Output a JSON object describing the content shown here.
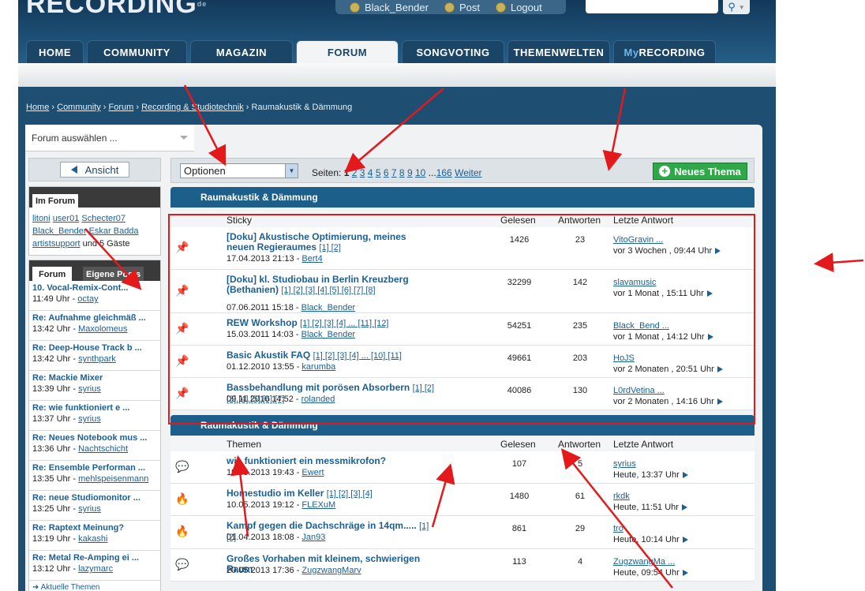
{
  "logo": {
    "text": "RECORDING",
    "suffix": "de"
  },
  "userbar": {
    "user": "Black_Bender",
    "post": "Post",
    "logout": "Logout"
  },
  "search": {
    "placeholder": ""
  },
  "nav": {
    "tabs": [
      "HOME",
      "COMMUNITY",
      "MAGAZIN",
      "FORUM",
      "SONGVOTING",
      "THEMENWELTEN"
    ],
    "my_prefix": "My",
    "my_suffix": "RECORDING",
    "active": "FORUM"
  },
  "breadcrumb": [
    "Home",
    "Community",
    "Forum",
    "Recording & Studiotechnik",
    "Raumakustik & Dämmung"
  ],
  "forum_select": {
    "label": "Forum auswählen ..."
  },
  "sidebar": {
    "ansicht": "Ansicht",
    "im_forum": {
      "title": "Im Forum",
      "users": [
        "litoni",
        "user01",
        "Schecter07",
        "Black_Bender",
        "Eskar Badda",
        "artistsupport"
      ],
      "guests": "und 5 Gäste"
    },
    "tabs": [
      "Forum",
      "Eigene Posts"
    ],
    "posts": [
      {
        "title": "10. Vocal-Remix-Cont...",
        "time": "11:49 Uhr",
        "user": "octay"
      },
      {
        "title": "Re: Aufnahme gleichmäß ...",
        "time": "13:42 Uhr",
        "user": "Maxolomeus"
      },
      {
        "title": "Re: Deep-House Track b ...",
        "time": "13:42 Uhr",
        "user": "synthpark"
      },
      {
        "title": "Re: Mackie Mixer",
        "time": "13:39 Uhr",
        "user": "syrius"
      },
      {
        "title": "Re: wie funktioniert e ...",
        "time": "13:37 Uhr",
        "user": "syrius"
      },
      {
        "title": "Re: Neues Notebook mus ...",
        "time": "13:36 Uhr",
        "user": "Nachtschicht"
      },
      {
        "title": "Re: Ensemble Performan ...",
        "time": "13:35 Uhr",
        "user": "mehlspeisenmann"
      },
      {
        "title": "Re: neue Studiomonitor ...",
        "time": "13:25 Uhr",
        "user": "syrius"
      },
      {
        "title": "Re: Raptext Meinung?",
        "time": "13:19 Uhr",
        "user": "kakashi"
      },
      {
        "title": "Re: Metal Re-Amping ei ...",
        "time": "13:12 Uhr",
        "user": "lazymarc"
      }
    ],
    "more": "Aktuelle Themen"
  },
  "toolbar": {
    "options": "Optionen",
    "pages_label": "Seiten:",
    "pages": [
      "1",
      "2",
      "3",
      "4",
      "5",
      "6",
      "7",
      "8",
      "9",
      "10"
    ],
    "ellipsis": "...",
    "last_page": "166",
    "next": "Weiter",
    "new_thread": "Neues Thema"
  },
  "columns": {
    "sticky": "Sticky",
    "themen": "Themen",
    "views": "Gelesen",
    "replies": "Antworten",
    "last": "Letzte Antwort"
  },
  "section_title": "Raumakustik & Dämmung",
  "sticky_threads": [
    {
      "title": "[Doku] Akustische Optimierung, meines neuen Regieraumes",
      "pages": "[1] [2]",
      "date": "17.04.2013 21:13",
      "author": "Bert4",
      "views": "1426",
      "replies": "23",
      "last_user": "VitoGravin ...",
      "last_time": "vor 3 Wochen , 09:44 Uhr"
    },
    {
      "title": "[Doku] kl. Studiobau in Berlin Kreuzberg (Bethanien)",
      "pages": "[1] [2] [3] [4] [5] [6] [7] [8]",
      "date": "07.06.2011 15:18",
      "author": "Black_Bender",
      "views": "32299",
      "replies": "142",
      "last_user": "slavamusic",
      "last_time": "vor 1 Monat , 15:11 Uhr"
    },
    {
      "title": "REW Workshop",
      "pages": "[1] [2] [3] [4] ... [11] [12]",
      "date": "15.03.2011 14:03",
      "author": "Black_Bender",
      "views": "54251",
      "replies": "235",
      "last_user": "Black_Bend ...",
      "last_time": "vor 1 Monat , 14:12 Uhr"
    },
    {
      "title": "Basic Akustik FAQ",
      "pages": "[1] [2] [3] [4] ... [10] [11]",
      "date": "01.12.2010 13:55",
      "author": "karumba",
      "views": "49661",
      "replies": "203",
      "last_user": "HoJS",
      "last_time": "vor 2 Monaten , 20:51 Uhr"
    },
    {
      "title": "Bassbehandlung mit porösen Absorbern",
      "pages": "[1] [2] [3] [4] [5] [6] [7]",
      "date": "09.11.2010 14:52",
      "author": "rolanded",
      "views": "40086",
      "replies": "130",
      "last_user": "L0rdVetina ...",
      "last_time": "vor 2 Monaten , 14:16 Uhr"
    }
  ],
  "threads": [
    {
      "title": "wie funktioniert ein messmikrofon?",
      "pages": "",
      "date": "19.05.2013 19:43",
      "author": "Ewert",
      "views": "107",
      "replies": "5",
      "last_user": "syrius",
      "last_time": "Heute, 13:37 Uhr"
    },
    {
      "title": "Homestudio im Keller",
      "pages": "[1] [2] [3] [4]",
      "date": "10.05.2013 19:12",
      "author": "FLEXuM",
      "views": "1480",
      "replies": "61",
      "last_user": "rkdk",
      "last_time": "Heute, 11:51 Uhr"
    },
    {
      "title": "Kampf gegen die Dachschräge in 14qm.....",
      "pages": "[1] [2]",
      "date": "01.04.2013 18:08",
      "author": "Jan93",
      "views": "861",
      "replies": "29",
      "last_user": "tro",
      "last_time": "Heute, 10:14 Uhr"
    },
    {
      "title": "Großes Vorhaben mit kleinem, schwierigen Raum",
      "pages": "",
      "date": "20.05.2013 17:36",
      "author": "ZugzwangMarv",
      "views": "113",
      "replies": "4",
      "last_user": "ZugzwangMa ...",
      "last_time": "Heute, 09:54 Uhr"
    }
  ],
  "colors": {
    "accent": "#1c5f8a",
    "annotation": "#e3191c",
    "new_button": "#2fa84a"
  }
}
